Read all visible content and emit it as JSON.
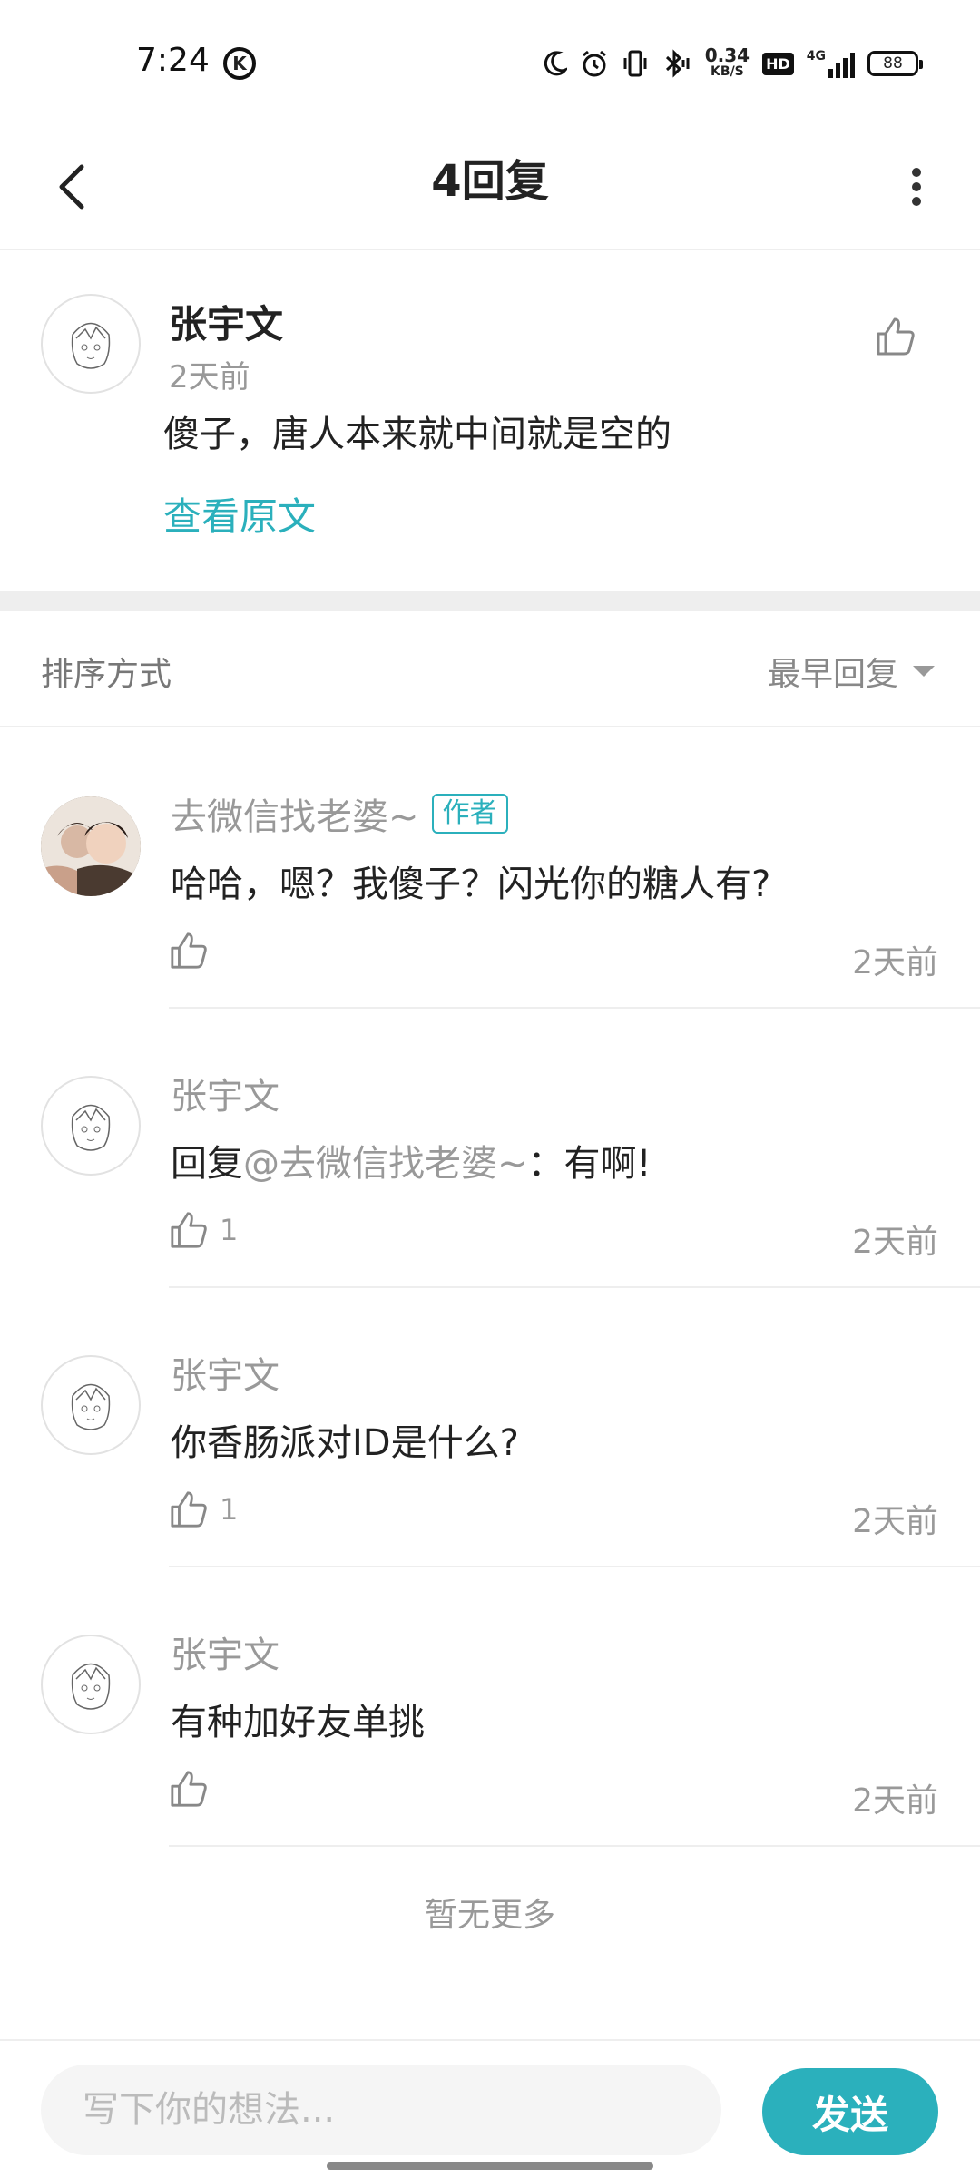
{
  "status_bar": {
    "time": "7:24",
    "k_badge": "K",
    "speed_value": "0.34",
    "speed_unit": "KB/S",
    "hd": "HD",
    "network": "4G",
    "battery": "88"
  },
  "header": {
    "title": "4回复"
  },
  "original_comment": {
    "author": "张宇文",
    "time": "2天前",
    "text": "傻子，唐人本来就中间就是空的",
    "view_original_label": "查看原文"
  },
  "sort": {
    "label": "排序方式",
    "value": "最早回复"
  },
  "replies": [
    {
      "author": "去微信找老婆~",
      "badge": "作者",
      "text": "哈哈，嗯？我傻子？闪光你的糖人有?",
      "likes": "",
      "time": "2天前"
    },
    {
      "author": "张宇文",
      "reply_prefix": "回复",
      "mention": "@去微信找老婆~",
      "text": "：有啊!",
      "likes": "1",
      "time": "2天前"
    },
    {
      "author": "张宇文",
      "text": "你香肠派对ID是什么?",
      "likes": "1",
      "time": "2天前"
    },
    {
      "author": "张宇文",
      "text": "有种加好友单挑",
      "likes": "",
      "time": "2天前"
    }
  ],
  "footer": {
    "no_more": "暂无更多"
  },
  "input": {
    "placeholder": "写下你的想法...",
    "send_label": "发送"
  },
  "colors": {
    "accent": "#2bb0bc",
    "muted": "#999999"
  }
}
